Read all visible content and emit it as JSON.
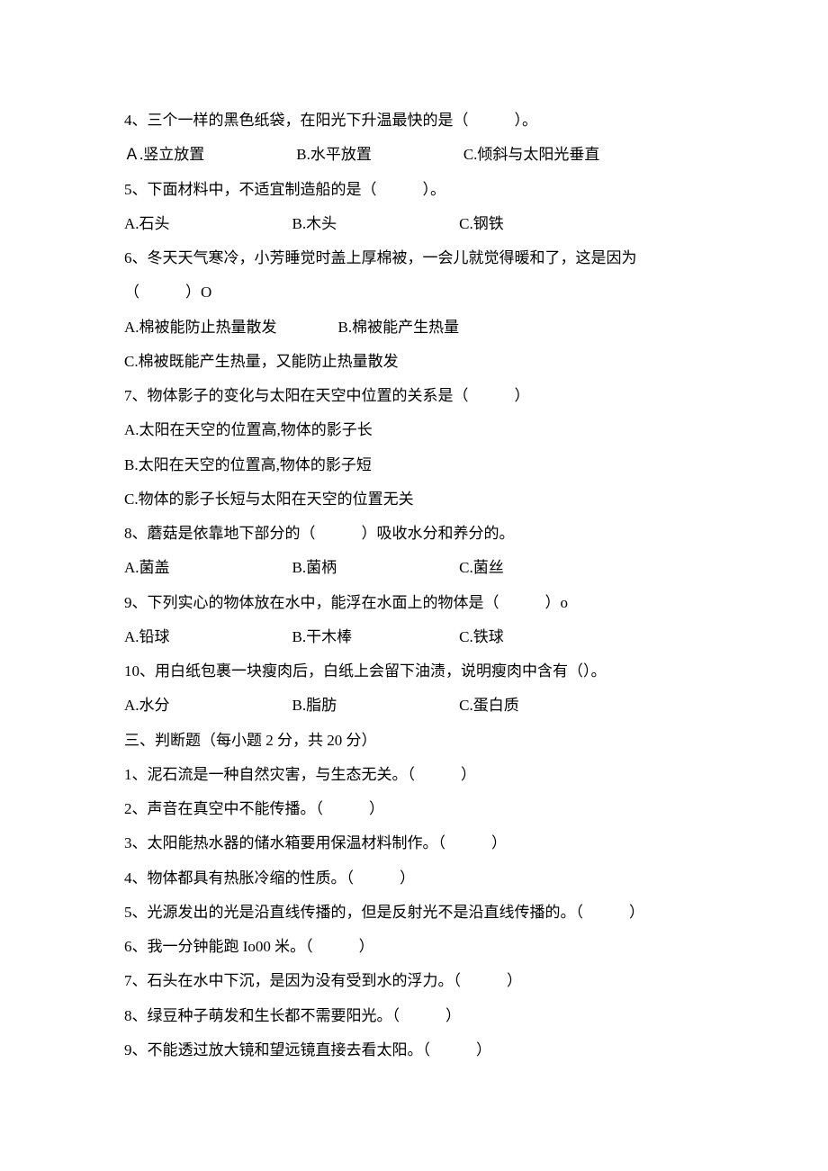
{
  "questions": {
    "q4": {
      "text": "4、三个一样的黑色纸袋，在阳光下升温最快的是（　　　）。",
      "options": "Ａ.竖立放置　　　　　　B.水平放置　　　　　　C.倾斜与太阳光垂直"
    },
    "q5": {
      "text": "5、下面材料中，不适宜制造船的是（　　　）。",
      "options": "A.石头　　　　　　　　B.木头　　　　　　　　C.钢铁"
    },
    "q6": {
      "text1": "6、冬天天气寒冷，小芳睡觉时盖上厚棉被，一会儿就觉得暖和了，这是因为",
      "text2": "（　　　）O",
      "optA": "A.棉被能防止热量散发　　　　B.棉被能产生热量",
      "optC": "C.棉被既能产生热量，又能防止热量散发"
    },
    "q7": {
      "text": "7、物体影子的变化与太阳在天空中位置的关系是（　　　）",
      "optA": "A.太阳在天空的位置高,物体的影子长",
      "optB": "B.太阳在天空的位置高,物体的影子短",
      "optC": "C.物体的影子长短与太阳在天空的位置无关"
    },
    "q8": {
      "text": "8、蘑菇是依靠地下部分的（　　　）吸收水分和养分的。",
      "options": "A.菌盖　　　　　　　　B.菌柄　　　　　　　　C.菌丝"
    },
    "q9": {
      "text": "9、下列实心的物体放在水中，能浮在水面上的物体是（　　　）o",
      "options": "A.铅球　　　　　　　　B.干木棒　　　　　　　C.铁球"
    },
    "q10": {
      "text": "10、用白纸包裹一块瘦肉后，白纸上会留下油渍，说明瘦肉中含有（）。",
      "options": "A.水分　　　　　　　　B.脂肪　　　　　　　　C.蛋白质"
    }
  },
  "section3": {
    "heading": "三、判断题（每小题 2 分，共 20 分）",
    "items": [
      "1、泥石流是一种自然灾害，与生态无关。（　　　）",
      "2、声音在真空中不能传播。（　　　）",
      "3、太阳能热水器的储水箱要用保温材料制作。（　　　）",
      "4、物体都具有热胀冷缩的性质。（　　　）",
      "5、光源发出的光是沿直线传播的，但是反射光不是沿直线传播的。（　　　）",
      "6、我一分钟能跑 Io00 米。（　　　）",
      "7、石头在水中下沉，是因为没有受到水的浮力。（　　　）",
      "8、绿豆种子萌发和生长都不需要阳光。（　　　）",
      "9、不能透过放大镜和望远镜直接去看太阳。（　　　）"
    ]
  }
}
